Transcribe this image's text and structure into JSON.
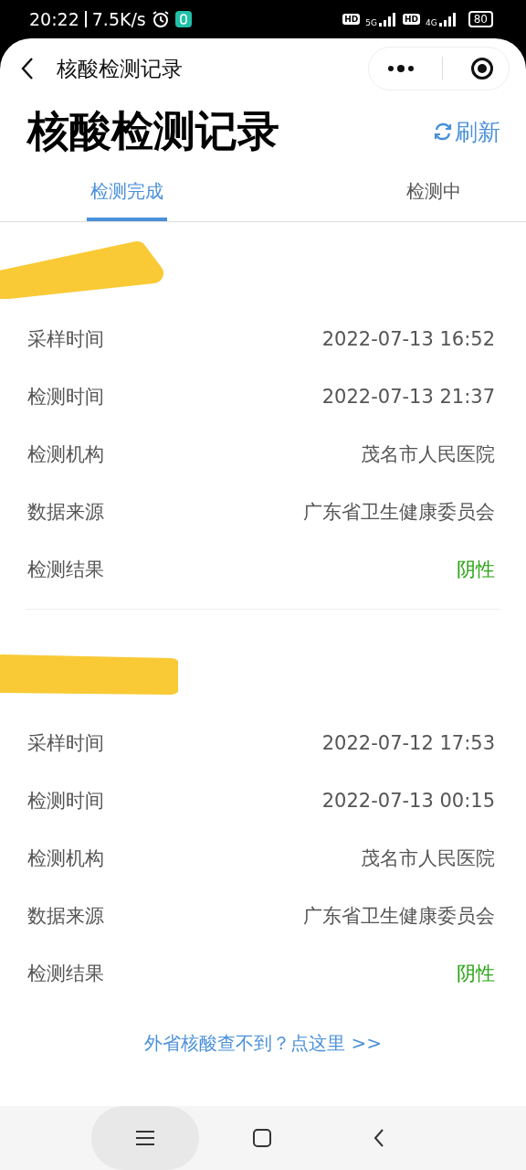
{
  "status_bar": {
    "time": "20:22",
    "speed": "7.5K/s",
    "networks": [
      {
        "badge": "HD",
        "type": "5G"
      },
      {
        "badge": "HD",
        "type": "4G"
      }
    ],
    "battery": "80"
  },
  "nav": {
    "title": "核酸检测记录"
  },
  "header": {
    "title": "核酸检测记录",
    "refresh": "刷新"
  },
  "tabs": [
    {
      "label": "检测完成",
      "selected": true
    },
    {
      "label": "检测中",
      "selected": false
    }
  ],
  "records": [
    {
      "fields": [
        {
          "label": "采样时间",
          "value": "2022-07-13 16:52",
          "kind": "text"
        },
        {
          "label": "检测时间",
          "value": "2022-07-13 21:37",
          "kind": "text"
        },
        {
          "label": "检测机构",
          "value": "茂名市人民医院",
          "kind": "text"
        },
        {
          "label": "数据来源",
          "value": "广东省卫生健康委员会",
          "kind": "text"
        },
        {
          "label": "检测结果",
          "value": "阴性",
          "kind": "result"
        }
      ]
    },
    {
      "fields": [
        {
          "label": "采样时间",
          "value": "2022-07-12 17:53",
          "kind": "text"
        },
        {
          "label": "检测时间",
          "value": "2022-07-13 00:15",
          "kind": "text"
        },
        {
          "label": "检测机构",
          "value": "茂名市人民医院",
          "kind": "text"
        },
        {
          "label": "数据来源",
          "value": "广东省卫生健康委员会",
          "kind": "text"
        },
        {
          "label": "检测结果",
          "value": "阴性",
          "kind": "result"
        }
      ]
    }
  ],
  "footer_link": "外省核酸查不到？点这里 >>"
}
